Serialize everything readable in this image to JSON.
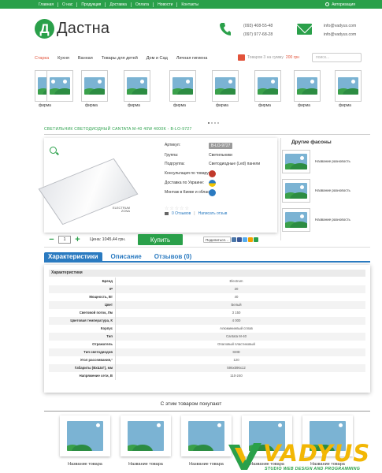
{
  "topnav": {
    "items": [
      "Главная",
      "О нас",
      "Продукция",
      "Доставка",
      "Оплата",
      "Новости",
      "Контакты"
    ],
    "auth": "Авторизация"
  },
  "header": {
    "logo_letter": "Д",
    "logo_text": "Дастна",
    "phone1": "(093) 408-55-48",
    "phone2": "(097) 977-68-28",
    "email1": "info@vadyus.com",
    "email2": "info@vadyus.com"
  },
  "mainnav": {
    "items": [
      "Старка",
      "Кухня",
      "Ванная",
      "Товары для детей",
      "Дом и Сад",
      "Личная гигиена"
    ],
    "cart_text": "Товаров 3 на сумму",
    "cart_sum": "200 грн",
    "search_placeholder": "поиск..."
  },
  "brands": [
    "фирма",
    "фирма",
    "фирма",
    "фирма",
    "фирма",
    "фирма",
    "фирма",
    "фирма"
  ],
  "product": {
    "title": "Светильник светодиодный CANTATA M-40 40W 4000K - B-LO-9727",
    "logo_top": "ELECTRUM",
    "logo_bottom": "ZONA",
    "specs": [
      {
        "label": "Артикул:",
        "value": "B-LO-9727"
      },
      {
        "label": "Группа:",
        "value": "Светильники"
      },
      {
        "label": "Подгруппа:",
        "value": "Светодиодные (Led) панели"
      },
      {
        "label": "Консультация по товару:",
        "value": ""
      },
      {
        "label": "Доставка по Украине:",
        "value": ""
      },
      {
        "label": "Монтаж в Киеве и области:",
        "value": ""
      }
    ],
    "stars": "☆☆☆☆☆",
    "reviews_link": "0 Отзывов",
    "write_review_link": "Написать отзыв",
    "qty": "1",
    "price": "Цена: 1045,44 грн.",
    "buy_label": "Купить",
    "share_label": "Поделиться…"
  },
  "sidebar": {
    "title": "Другие фасоны",
    "items": [
      "Название разновость",
      "Название разновость",
      "Название разновость"
    ]
  },
  "tabs": [
    "Характеристики",
    "Описание",
    "Отзывов (0)"
  ],
  "table": {
    "header": "Характеристики",
    "rows": [
      {
        "k": "Бренд",
        "v": "Electrum"
      },
      {
        "k": "IP",
        "v": "20"
      },
      {
        "k": "Мощность, Вт",
        "v": "40"
      },
      {
        "k": "Цвет",
        "v": "Белый"
      },
      {
        "k": "Световой поток, Лм",
        "v": "3 150"
      },
      {
        "k": "Цветовая температура, К",
        "v": "4 000"
      },
      {
        "k": "Корпус",
        "v": "Алюминиевый сплав"
      },
      {
        "k": "Тип",
        "v": "Cantata M-40"
      },
      {
        "k": "Отражатель",
        "v": "Опаловый пластиковый"
      },
      {
        "k": "Тип светодиодов",
        "v": "SMD"
      },
      {
        "k": "Угол рассеивания,°",
        "v": "120"
      },
      {
        "k": "Габариты (ВхШхГ), мм",
        "v": "596х596х12"
      },
      {
        "k": "Напряжение сети, В",
        "v": "110-240"
      }
    ]
  },
  "also": {
    "title": "С этим товаром покупают",
    "items": [
      "Название товара",
      "Название товара",
      "Название товара",
      "Название товара",
      "Название товара"
    ]
  },
  "watermark": {
    "text": "VADYUS",
    "sub": "STUDIO WEB DESIGN AND PROGRAMMING"
  },
  "colors": {
    "brand_green": "#2aa04a",
    "link_blue": "#2a7ac0",
    "accent_red": "#e2533b",
    "watermark_yellow": "#f2b705"
  }
}
